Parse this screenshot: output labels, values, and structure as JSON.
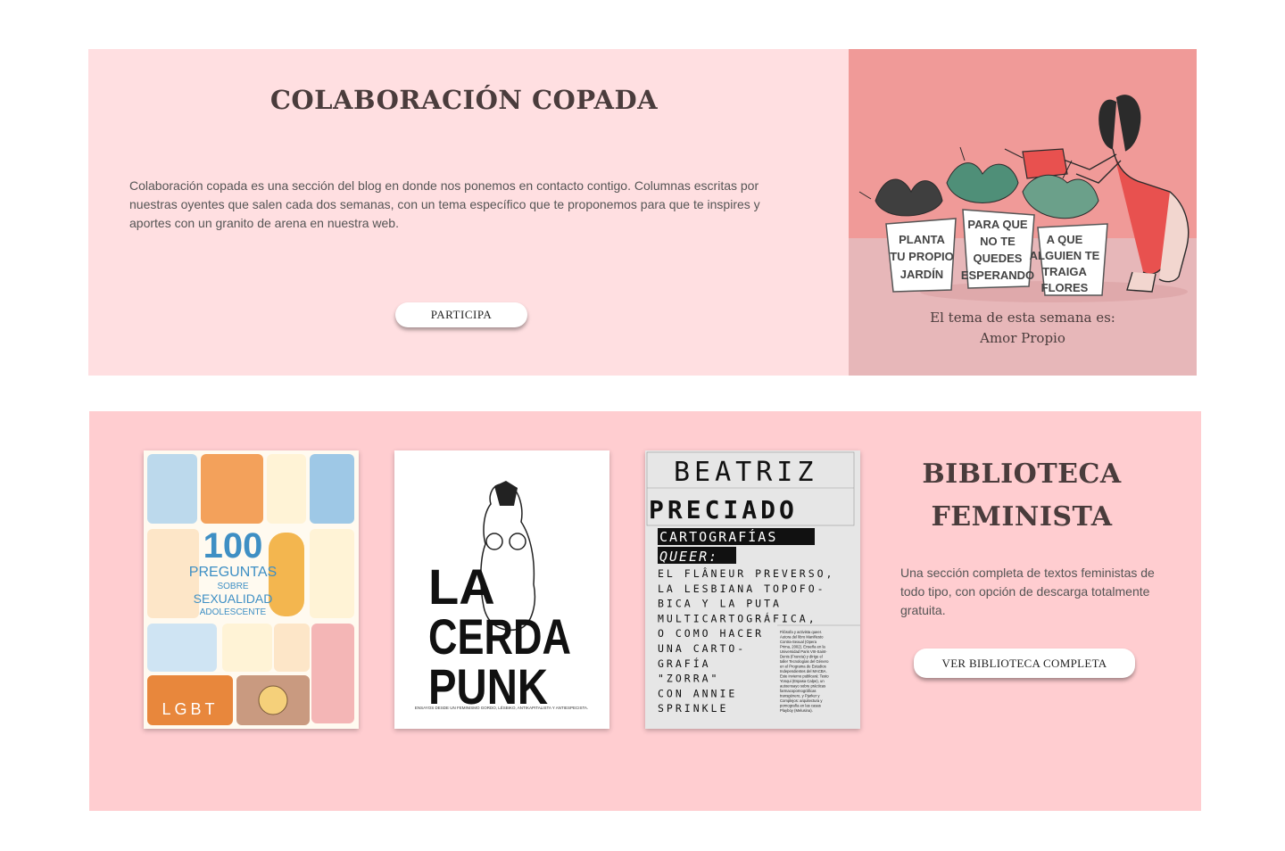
{
  "collab": {
    "title": "COLABORACIÓN COPADA",
    "description": "Colaboración copada es una sección del blog en donde nos ponemos en contacto contigo. Columnas escritas por nuestras oyentes que salen cada dos semanas, con un tema específico que te proponemos para que te inspires y aportes con un granito de arena en nuestra web.",
    "button_label": "PARTICIPA",
    "illustration": {
      "pot1": [
        "PLANTA",
        "TU PROPIO",
        "JARDÍN"
      ],
      "pot2": [
        "PARA QUE",
        "NO TE",
        "QUEDES",
        "ESPERANDO"
      ],
      "pot3": [
        "A QUE",
        "ALGUIEN TE",
        "TRAIGA",
        "FLORES"
      ]
    },
    "theme_line1": "El tema de esta semana es:",
    "theme_line2": "Amor Propio"
  },
  "biblio": {
    "title_line1": "BIBLIOTECA",
    "title_line2": "FEMINISTA",
    "description": "Una sección completa de textos feministas de todo tipo, con opción de descarga totalmente gratuita.",
    "button_label": "VER BIBLIOTECA COMPLETA",
    "books": [
      {
        "number": "100",
        "line1": "PREGUNTAS",
        "line2": "SOBRE",
        "line3": "SEXUALIDAD",
        "line4": "ADOLESCENTE",
        "footer": "LGBT"
      },
      {
        "line1": "LA",
        "line2": "CERDA",
        "line3": "PUNK",
        "subtitle": "ENSAYOS DESDE UN FEMINISMO GORDO, LÉSBIKO, ANTIKAPITALISTA Y ANTIESPECISTA."
      },
      {
        "author1": "BEATRIZ",
        "author2": "PRECIADO",
        "title1": "CARTOGRAFÍAS",
        "title2": "QUEER:",
        "lines": [
          "EL FLÂNEUR PREVERSO,",
          "LA LESBIANA TOPOFO-",
          "BICA Y LA PUTA",
          "MULTICARTOGRÁFICA,",
          "O COMO HACER",
          "UNA CARTO-",
          "GRAFÍA",
          "\"ZORRA\"",
          "CON ANNIE",
          "SPRINKLE"
        ],
        "bio": [
          "Filósofa y activista queer.",
          "Autora del libro Manifiesto",
          "Contra-Sexual (Opera",
          "Prima, 2002). Enseña en la",
          "Universidad Paris VIII-Saint-",
          "Denis (Francia) y dirige el",
          "taller Tecnologías del Género",
          "en el Programa de Estudios",
          "Independientes del MACBA.",
          "Este invierno publicará: Testo",
          "Yonqui (Espasa Calpe), un",
          "autoensayo sobre prácticas",
          "farmacopornográficas",
          "transgénero, y Pjarker y",
          "Complejos: arquitectura y",
          "pornografía en las casas",
          "Playboy (Melusina)."
        ]
      }
    ]
  }
}
